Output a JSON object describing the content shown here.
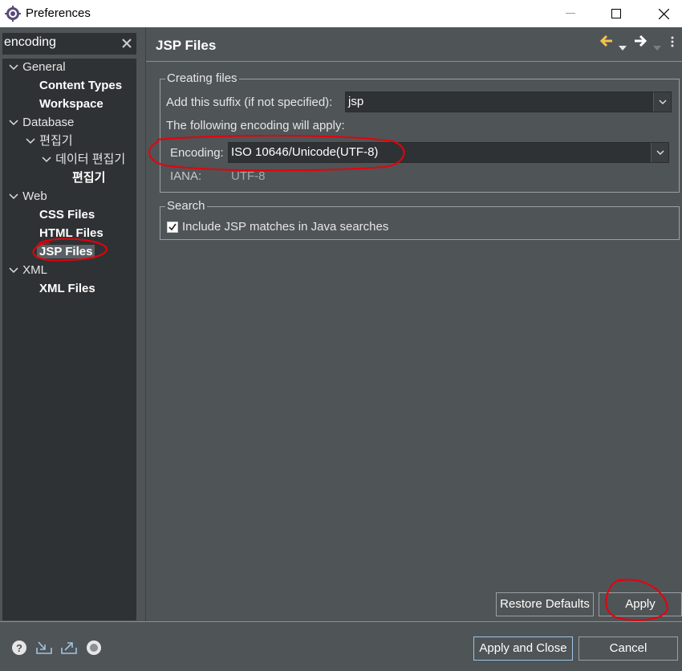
{
  "window": {
    "title": "Preferences"
  },
  "filter": {
    "value": "encoding"
  },
  "tree": {
    "general": "General",
    "content_types": "Content Types",
    "workspace": "Workspace",
    "database": "Database",
    "editor": "편집기",
    "data_editor": "데이터 편집기",
    "editor_leaf": "편집기",
    "web": "Web",
    "css_files": "CSS Files",
    "html_files": "HTML Files",
    "jsp_files": "JSP Files",
    "xml": "XML",
    "xml_files": "XML Files"
  },
  "page": {
    "title": "JSP Files",
    "creating_group": "Creating files",
    "suffix_label": "Add this suffix (if not specified):",
    "suffix_value": "jsp",
    "encoding_note": "The following encoding will apply:",
    "encoding_label": "Encoding:",
    "encoding_value": "ISO 10646/Unicode(UTF-8)",
    "iana_label": "IANA:",
    "iana_value": "UTF-8",
    "search_group": "Search",
    "include_jsp": "Include JSP matches in Java searches",
    "include_jsp_checked": true
  },
  "buttons": {
    "restore_defaults": "Restore Defaults",
    "apply": "Apply",
    "apply_and_close": "Apply and Close",
    "cancel": "Cancel"
  },
  "icons": {
    "app": "eclipse-gear-icon",
    "back": "arrow-left-icon",
    "forward": "arrow-right-icon",
    "menu": "vertical-dots-icon",
    "help": "help-icon",
    "import": "import-icon",
    "export": "export-icon",
    "oomph": "record-icon"
  },
  "colors": {
    "background": "#4f5457",
    "field": "#2f3234",
    "annotation": "#e8000b",
    "nav_arrow_back": "#f2c24b"
  }
}
